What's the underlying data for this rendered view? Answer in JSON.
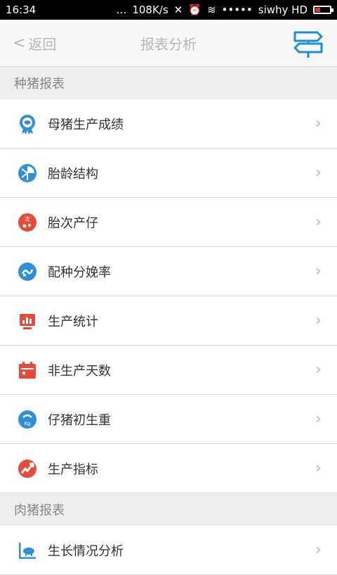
{
  "status_bar": {
    "time": "16:34",
    "speed": "108K/s",
    "carrier": "siwhy HD",
    "signal_dots": "•••••"
  },
  "header": {
    "back_label": "返回",
    "title": "报表分析"
  },
  "sections": [
    {
      "title": "种猪报表",
      "items": [
        {
          "label": "母猪生产成绩",
          "icon": "sow-award-icon",
          "color": "#2f8fd8"
        },
        {
          "label": "胎龄结构",
          "icon": "pie-structure-icon",
          "color": "#2f8fd8"
        },
        {
          "label": "胎次产仔",
          "icon": "piglet-birth-icon",
          "color": "#e44b3a"
        },
        {
          "label": "配种分娩率",
          "icon": "breeding-rate-icon",
          "color": "#2f8fd8"
        },
        {
          "label": "生产统计",
          "icon": "bar-statistics-icon",
          "color": "#e44b3a"
        },
        {
          "label": "非生产天数",
          "icon": "calendar-icon",
          "color": "#e44b3a"
        },
        {
          "label": "仔猪初生重",
          "icon": "weight-kg-icon",
          "color": "#2f8fd8"
        },
        {
          "label": "生产指标",
          "icon": "trend-up-icon",
          "color": "#e44b3a"
        }
      ]
    },
    {
      "title": "肉猪报表",
      "items": [
        {
          "label": "生长情况分析",
          "icon": "pig-growth-icon",
          "color": "#2f8fd8"
        }
      ]
    }
  ]
}
